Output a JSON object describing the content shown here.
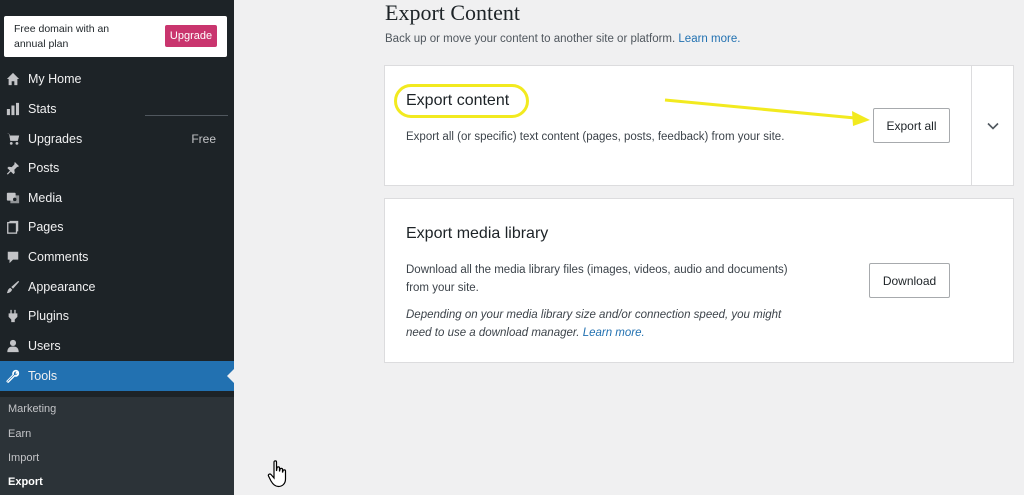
{
  "sidebar": {
    "promo_text": "Free domain with an annual plan",
    "upgrade_label": "Upgrade",
    "menu": [
      {
        "label": "My Home",
        "icon": "home-icon"
      },
      {
        "label": "Stats",
        "icon": "stats-icon"
      },
      {
        "label": "Upgrades",
        "icon": "cart-icon",
        "badge": "Free"
      },
      {
        "label": "Posts",
        "icon": "pin-icon"
      },
      {
        "label": "Media",
        "icon": "media-icon"
      },
      {
        "label": "Pages",
        "icon": "pages-icon"
      },
      {
        "label": "Comments",
        "icon": "comment-icon"
      },
      {
        "label": "Appearance",
        "icon": "brush-icon"
      },
      {
        "label": "Plugins",
        "icon": "plugin-icon"
      },
      {
        "label": "Users",
        "icon": "user-icon"
      },
      {
        "label": "Tools",
        "icon": "wrench-icon",
        "active": true
      }
    ],
    "submenu": [
      "Marketing",
      "Earn",
      "Import",
      "Export"
    ],
    "current_submenu": "Export"
  },
  "main": {
    "title": "Export Content",
    "description": "Back up or move your content to another site or platform.",
    "learn_more": "Learn more.",
    "export_content": {
      "title": "Export content",
      "text": "Export all (or specific) text content (pages, posts, feedback) from your site.",
      "button": "Export all"
    },
    "media": {
      "title": "Export media library",
      "text": "Download all the media library files (images, videos, audio and documents) from your site.",
      "note": "Depending on your media library size and/or connection speed, you might need to use a download manager.",
      "note_link": "Learn more.",
      "button": "Download"
    }
  },
  "colors": {
    "sidebar_bg": "#1d2327",
    "accent": "#2271b1",
    "upgrade": "#c9356e",
    "annotation": "#f2ea1f"
  }
}
